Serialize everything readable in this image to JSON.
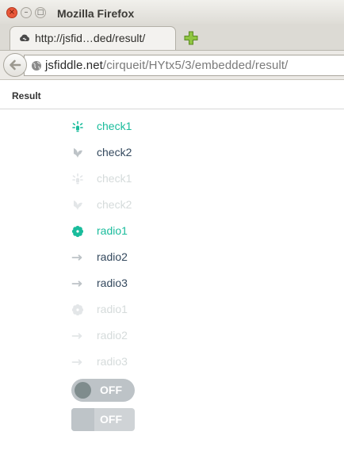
{
  "window": {
    "title": "Mozilla Firefox",
    "close_glyph": "×",
    "min_glyph": "–",
    "max_glyph": "□"
  },
  "tab": {
    "title": "http://jsfid…ded/result/",
    "favicon": "jsfiddle-cloud-icon"
  },
  "newtab": {
    "icon": "plus-icon"
  },
  "address": {
    "host": "jsfiddle.net",
    "path": "/cirqueit/HYtx5/3/embedded/result/"
  },
  "result": {
    "header": "Result"
  },
  "options": [
    {
      "label": "check1",
      "state": "active",
      "icon": "checkbox-checked-icon"
    },
    {
      "label": "check2",
      "state": "normal",
      "icon": "checkbox-icon"
    },
    {
      "label": "check1",
      "state": "disabled",
      "icon": "checkbox-checked-icon"
    },
    {
      "label": "check2",
      "state": "disabled",
      "icon": "checkbox-icon"
    },
    {
      "label": "radio1",
      "state": "active",
      "icon": "radio-checked-icon"
    },
    {
      "label": "radio2",
      "state": "normal",
      "icon": "radio-icon"
    },
    {
      "label": "radio3",
      "state": "normal",
      "icon": "radio-icon"
    },
    {
      "label": "radio1",
      "state": "disabled",
      "icon": "radio-checked-icon"
    },
    {
      "label": "radio2",
      "state": "disabled",
      "icon": "radio-icon"
    },
    {
      "label": "radio3",
      "state": "disabled",
      "icon": "radio-icon"
    }
  ],
  "toggles": [
    {
      "label": "OFF",
      "state": "off",
      "style": "round"
    },
    {
      "label": "OFF",
      "state": "off",
      "style": "square"
    }
  ],
  "colors": {
    "accent": "#1abc9c",
    "text": "#34495e",
    "muted": "#bdc3c7",
    "disabled": "#d5dbdb"
  }
}
